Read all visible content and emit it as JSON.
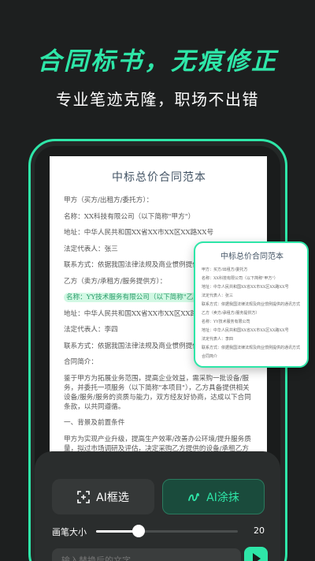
{
  "headline": "合同标书，无痕修正",
  "subline": "专业笔迹克隆，职场不出错",
  "document": {
    "title": "中标总价合同范本",
    "lines": [
      "甲方（买方/出租方/委托方）：",
      "名称：XX科技有限公司（以下简称\"甲方\"）",
      "地址：中华人民共和国XX省XX市XX区XX路XX号",
      "法定代表人：张三",
      "联系方式：依据我国法律法规及商业惯例提供的通讯方式",
      "乙方（卖方/承租方/服务提供方）：",
      "名称：YY技术服务有限公司（以下简称\"乙方\"）",
      "地址：中华人民共和国XX省XX市XX区XX路XX号",
      "法定代表人：李四",
      "联系方式：依据我国法律法规及商业惯例提供的通讯方式",
      "合同简介：",
      "鉴于甲方为拓展业务范围，提高企业效益，需采购一批设备/服务，并委托一项服务（以下简称\"本项目\"），乙方具备提供相关设备/服务/服务的资质与能力，双方经友好协商，达成以下合同条款，以共同遵循。",
      "一、背景及前置条件",
      "甲方为实现产业升级，提高生产效率/改善办公环境/提升服务质量，拟过市场调研及评估，决定采购乙方提供的设备/承租乙方的房产/委托乙方提供相关服务。"
    ]
  },
  "zoom": {
    "title": "中标总价合同范本",
    "lines": [
      "甲方：买方/出租方/委托方",
      "名称：XX科技有限公司（以下简称\"甲方\"）",
      "地址：中华人民共和国XX省XX市XX区XX路XX号",
      "法定代表人：张三",
      "联系方式：依据我国法律法规及商业惯例提供的通讯方式",
      "乙方（卖方/承租方/服务提供方）",
      "名称：YY技术服务有限公司",
      "地址：中华人民共和国XX省XX市XX区XX路XX号",
      "法定代表人：李四",
      "联系方式：依据我国法律法规及商业惯例提供的通讯方式",
      "合同简介"
    ]
  },
  "toolbar": {
    "frame_label": "AI框选",
    "erase_label": "AI涂抹",
    "brush_label": "画笔大小",
    "brush_value": "20",
    "brush_fraction": 0.3,
    "input_placeholder": "输入替换后的文字"
  },
  "colors": {
    "accent": "#2ee6a8",
    "background": "#1d1f1f"
  }
}
